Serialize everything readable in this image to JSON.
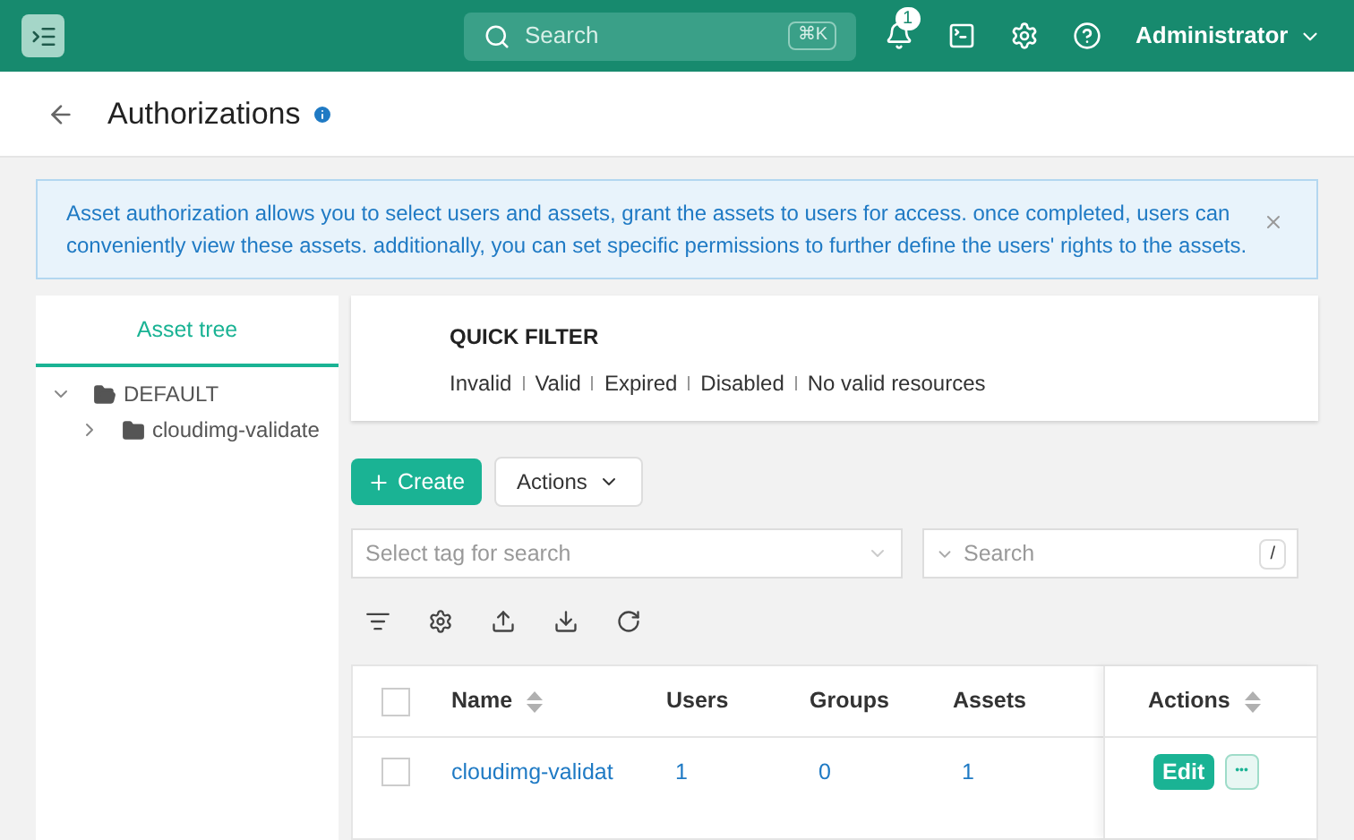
{
  "topbar": {
    "search": {
      "placeholder": "Search",
      "shortcut": "⌘K"
    },
    "notifications": {
      "count": "1"
    },
    "user": "Administrator"
  },
  "page": {
    "title": "Authorizations"
  },
  "alert": {
    "text": "Asset authorization allows you to select users and assets, grant the assets to users for access. once completed, users can conveniently view these assets. additionally, you can set specific permissions to further define the users' rights to the assets."
  },
  "sidebar": {
    "tabs": [
      {
        "label": "Asset tree",
        "selected": true
      }
    ],
    "tree": [
      {
        "label": "DEFAULT",
        "expanded": true,
        "children": [
          {
            "label": "cloudimg-validate",
            "expanded": false
          }
        ]
      }
    ]
  },
  "quick_filter": {
    "title": "QUICK FILTER",
    "options": [
      "Invalid",
      "Valid",
      "Expired",
      "Disabled",
      "No valid resources"
    ]
  },
  "toolbar": {
    "create": "Create",
    "actions": "Actions",
    "tag_search": {
      "placeholder": "Select tag for search"
    },
    "search": {
      "placeholder": "Search",
      "shortcut": "/"
    }
  },
  "table": {
    "columns": [
      {
        "label": "Name",
        "sortable": true
      },
      {
        "label": "Users",
        "sortable": false
      },
      {
        "label": "Groups",
        "sortable": false
      },
      {
        "label": "Assets",
        "sortable": false
      }
    ],
    "actions_column": {
      "label": "Actions",
      "sortable": true
    },
    "select_all": {
      "checked": false
    },
    "rows": [
      {
        "checked": false,
        "cells": [
          "cloudimg-validat",
          "1",
          "0",
          "1"
        ],
        "edit": "Edit",
        "more": "•••"
      }
    ]
  }
}
